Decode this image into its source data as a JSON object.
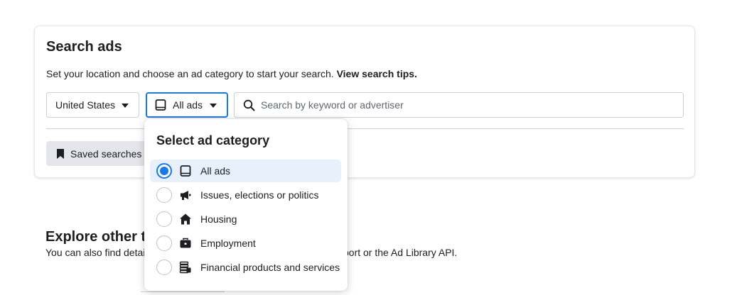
{
  "search_card": {
    "title": "Search ads",
    "subtitle": "Set your location and choose an ad category to start your search.",
    "tips_link": "View search tips.",
    "country_value": "United States",
    "category_value": "All ads",
    "search_placeholder": "Search by keyword or advertiser",
    "saved_searches_label": "Saved searches"
  },
  "explore": {
    "title": "Explore other to",
    "subtitle_start": "You can also find detai",
    "subtitle_end": "port or the Ad Library API."
  },
  "dropdown": {
    "title": "Select ad category",
    "options": [
      {
        "label": "All ads",
        "icon": "tablet-icon",
        "selected": true
      },
      {
        "label": "Issues, elections or politics",
        "icon": "megaphone-icon",
        "selected": false
      },
      {
        "label": "Housing",
        "icon": "house-icon",
        "selected": false
      },
      {
        "label": "Employment",
        "icon": "briefcase-icon",
        "selected": false
      },
      {
        "label": "Financial products and services",
        "icon": "coins-icon",
        "selected": false
      }
    ]
  },
  "colors": {
    "accent": "#1877f2",
    "selected_bg": "#e7f0fb",
    "button_bg": "#e4e6eb",
    "text": "#1c1e21"
  }
}
